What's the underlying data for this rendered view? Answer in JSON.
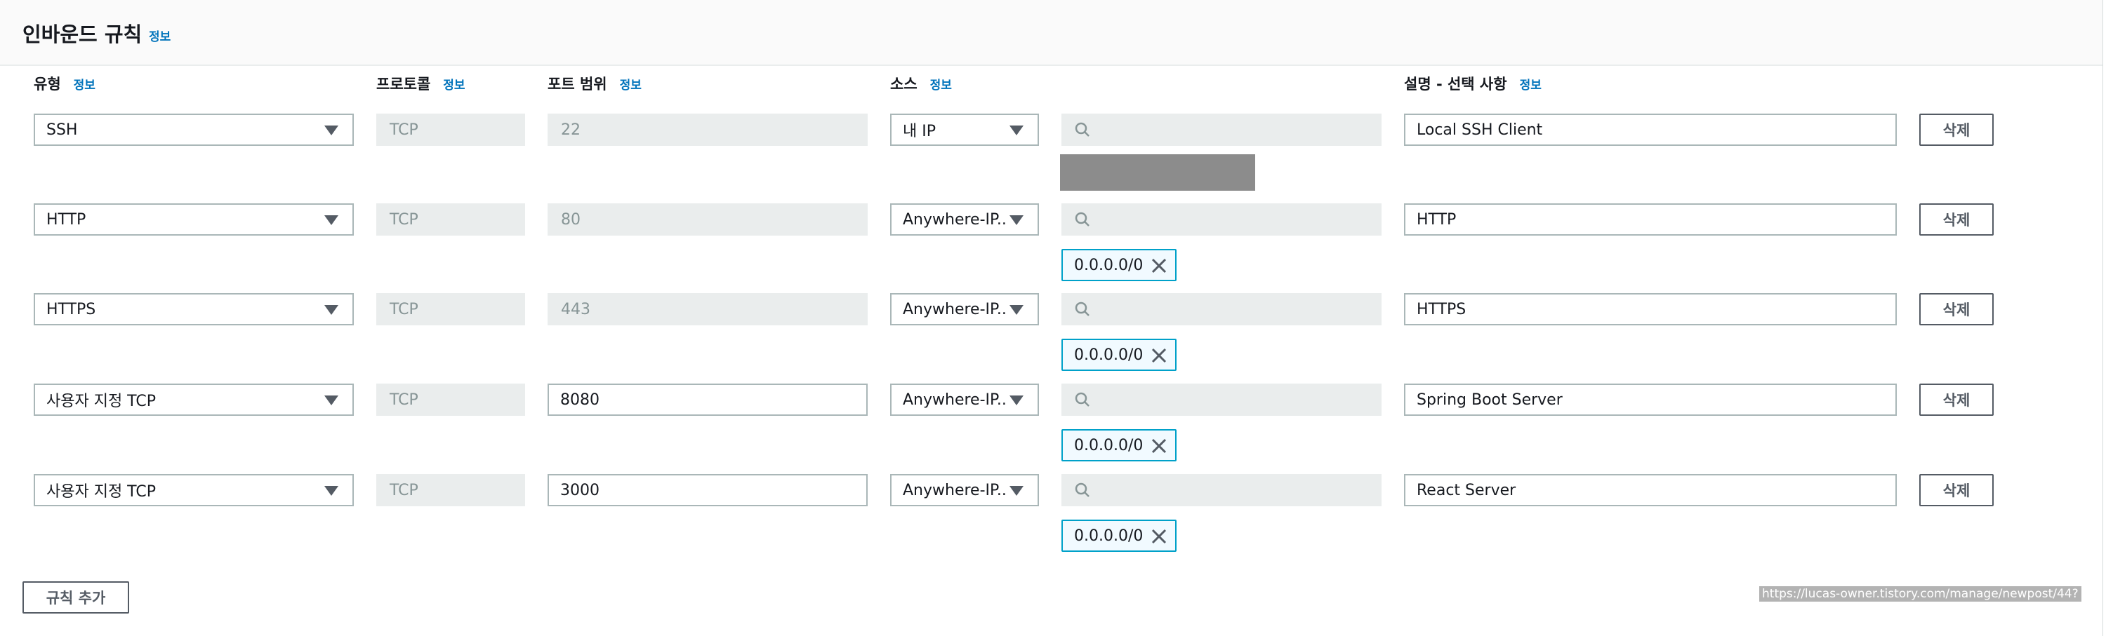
{
  "section": {
    "title": "인바운드 규칙",
    "info": "정보"
  },
  "columns": {
    "type": "유형",
    "protocol": "프로토콜",
    "port": "포트 범위",
    "source": "소스",
    "description": "설명 - 선택 사항",
    "info": "정보"
  },
  "rules": [
    {
      "type": "SSH",
      "protocol": "TCP",
      "port": "22",
      "port_editable": false,
      "source": "내 IP",
      "token": "",
      "description": "Local SSH Client",
      "delete": "삭제"
    },
    {
      "type": "HTTP",
      "protocol": "TCP",
      "port": "80",
      "port_editable": false,
      "source": "Anywhere-IP...",
      "token": "0.0.0.0/0",
      "description": "HTTP",
      "delete": "삭제"
    },
    {
      "type": "HTTPS",
      "protocol": "TCP",
      "port": "443",
      "port_editable": false,
      "source": "Anywhere-IP...",
      "token": "0.0.0.0/0",
      "description": "HTTPS",
      "delete": "삭제"
    },
    {
      "type": "사용자 지정 TCP",
      "protocol": "TCP",
      "port": "8080",
      "port_editable": true,
      "source": "Anywhere-IP...",
      "token": "0.0.0.0/0",
      "description": "Spring Boot Server",
      "delete": "삭제"
    },
    {
      "type": "사용자 지정 TCP",
      "protocol": "TCP",
      "port": "3000",
      "port_editable": true,
      "source": "Anywhere-IP...",
      "token": "0.0.0.0/0",
      "description": "React Server",
      "delete": "삭제"
    }
  ],
  "add_rule": "규칙 추가",
  "url_overlay": "https://lucas-owner.tistory.com/manage/newpost/44?",
  "colors": {
    "accent": "#0073bb",
    "token_border": "#00a1c9",
    "disabled_bg": "#eaeded"
  }
}
